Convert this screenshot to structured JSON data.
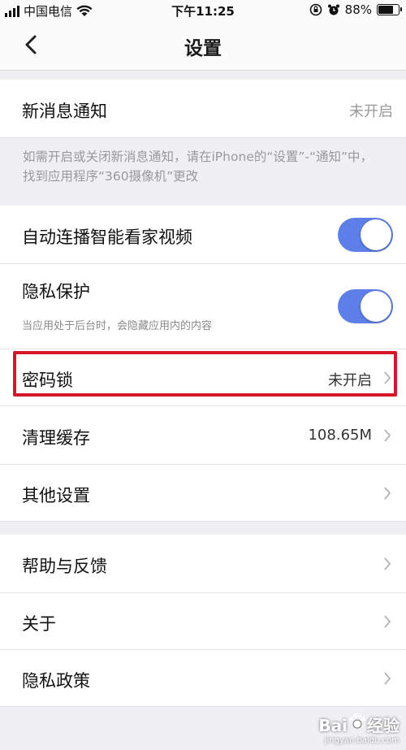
{
  "status_bar": {
    "carrier": "中国电信",
    "time": "下午11:25",
    "battery": "88%",
    "battery_level": 0.88,
    "icons": [
      "signal-icon",
      "wifi-icon",
      "rotation-lock-icon",
      "alarm-icon",
      "battery-icon"
    ]
  },
  "nav": {
    "title": "设置",
    "back_icon": "back-chevron-icon"
  },
  "notifications": {
    "label": "新消息通知",
    "value": "未开启",
    "note": "如需开启或关闭新消息通知，请在iPhone的“设置”-“通知”中，找到应用程序“360摄像机”更改"
  },
  "autoplay": {
    "label": "自动连播智能看家视频",
    "enabled": true
  },
  "privacy": {
    "label": "隐私保护",
    "sub": "当应用处于后台时，会隐藏应用内的内容",
    "enabled": true
  },
  "password_lock": {
    "label": "密码锁",
    "value": "未开启",
    "highlight_color": "#d6172a"
  },
  "clear_cache": {
    "label": "清理缓存",
    "value": "108.65M"
  },
  "other_settings": {
    "label": "其他设置"
  },
  "help": {
    "label": "帮助与反馈"
  },
  "about": {
    "label": "关于"
  },
  "privacy_policy": {
    "label": "隐私政策"
  },
  "colors": {
    "toggle_on": "#5f7fe8",
    "background": "#efeff4"
  },
  "watermark": {
    "text": "Bai",
    "text2": "经验",
    "sub": "jingyan.baidu.com"
  }
}
